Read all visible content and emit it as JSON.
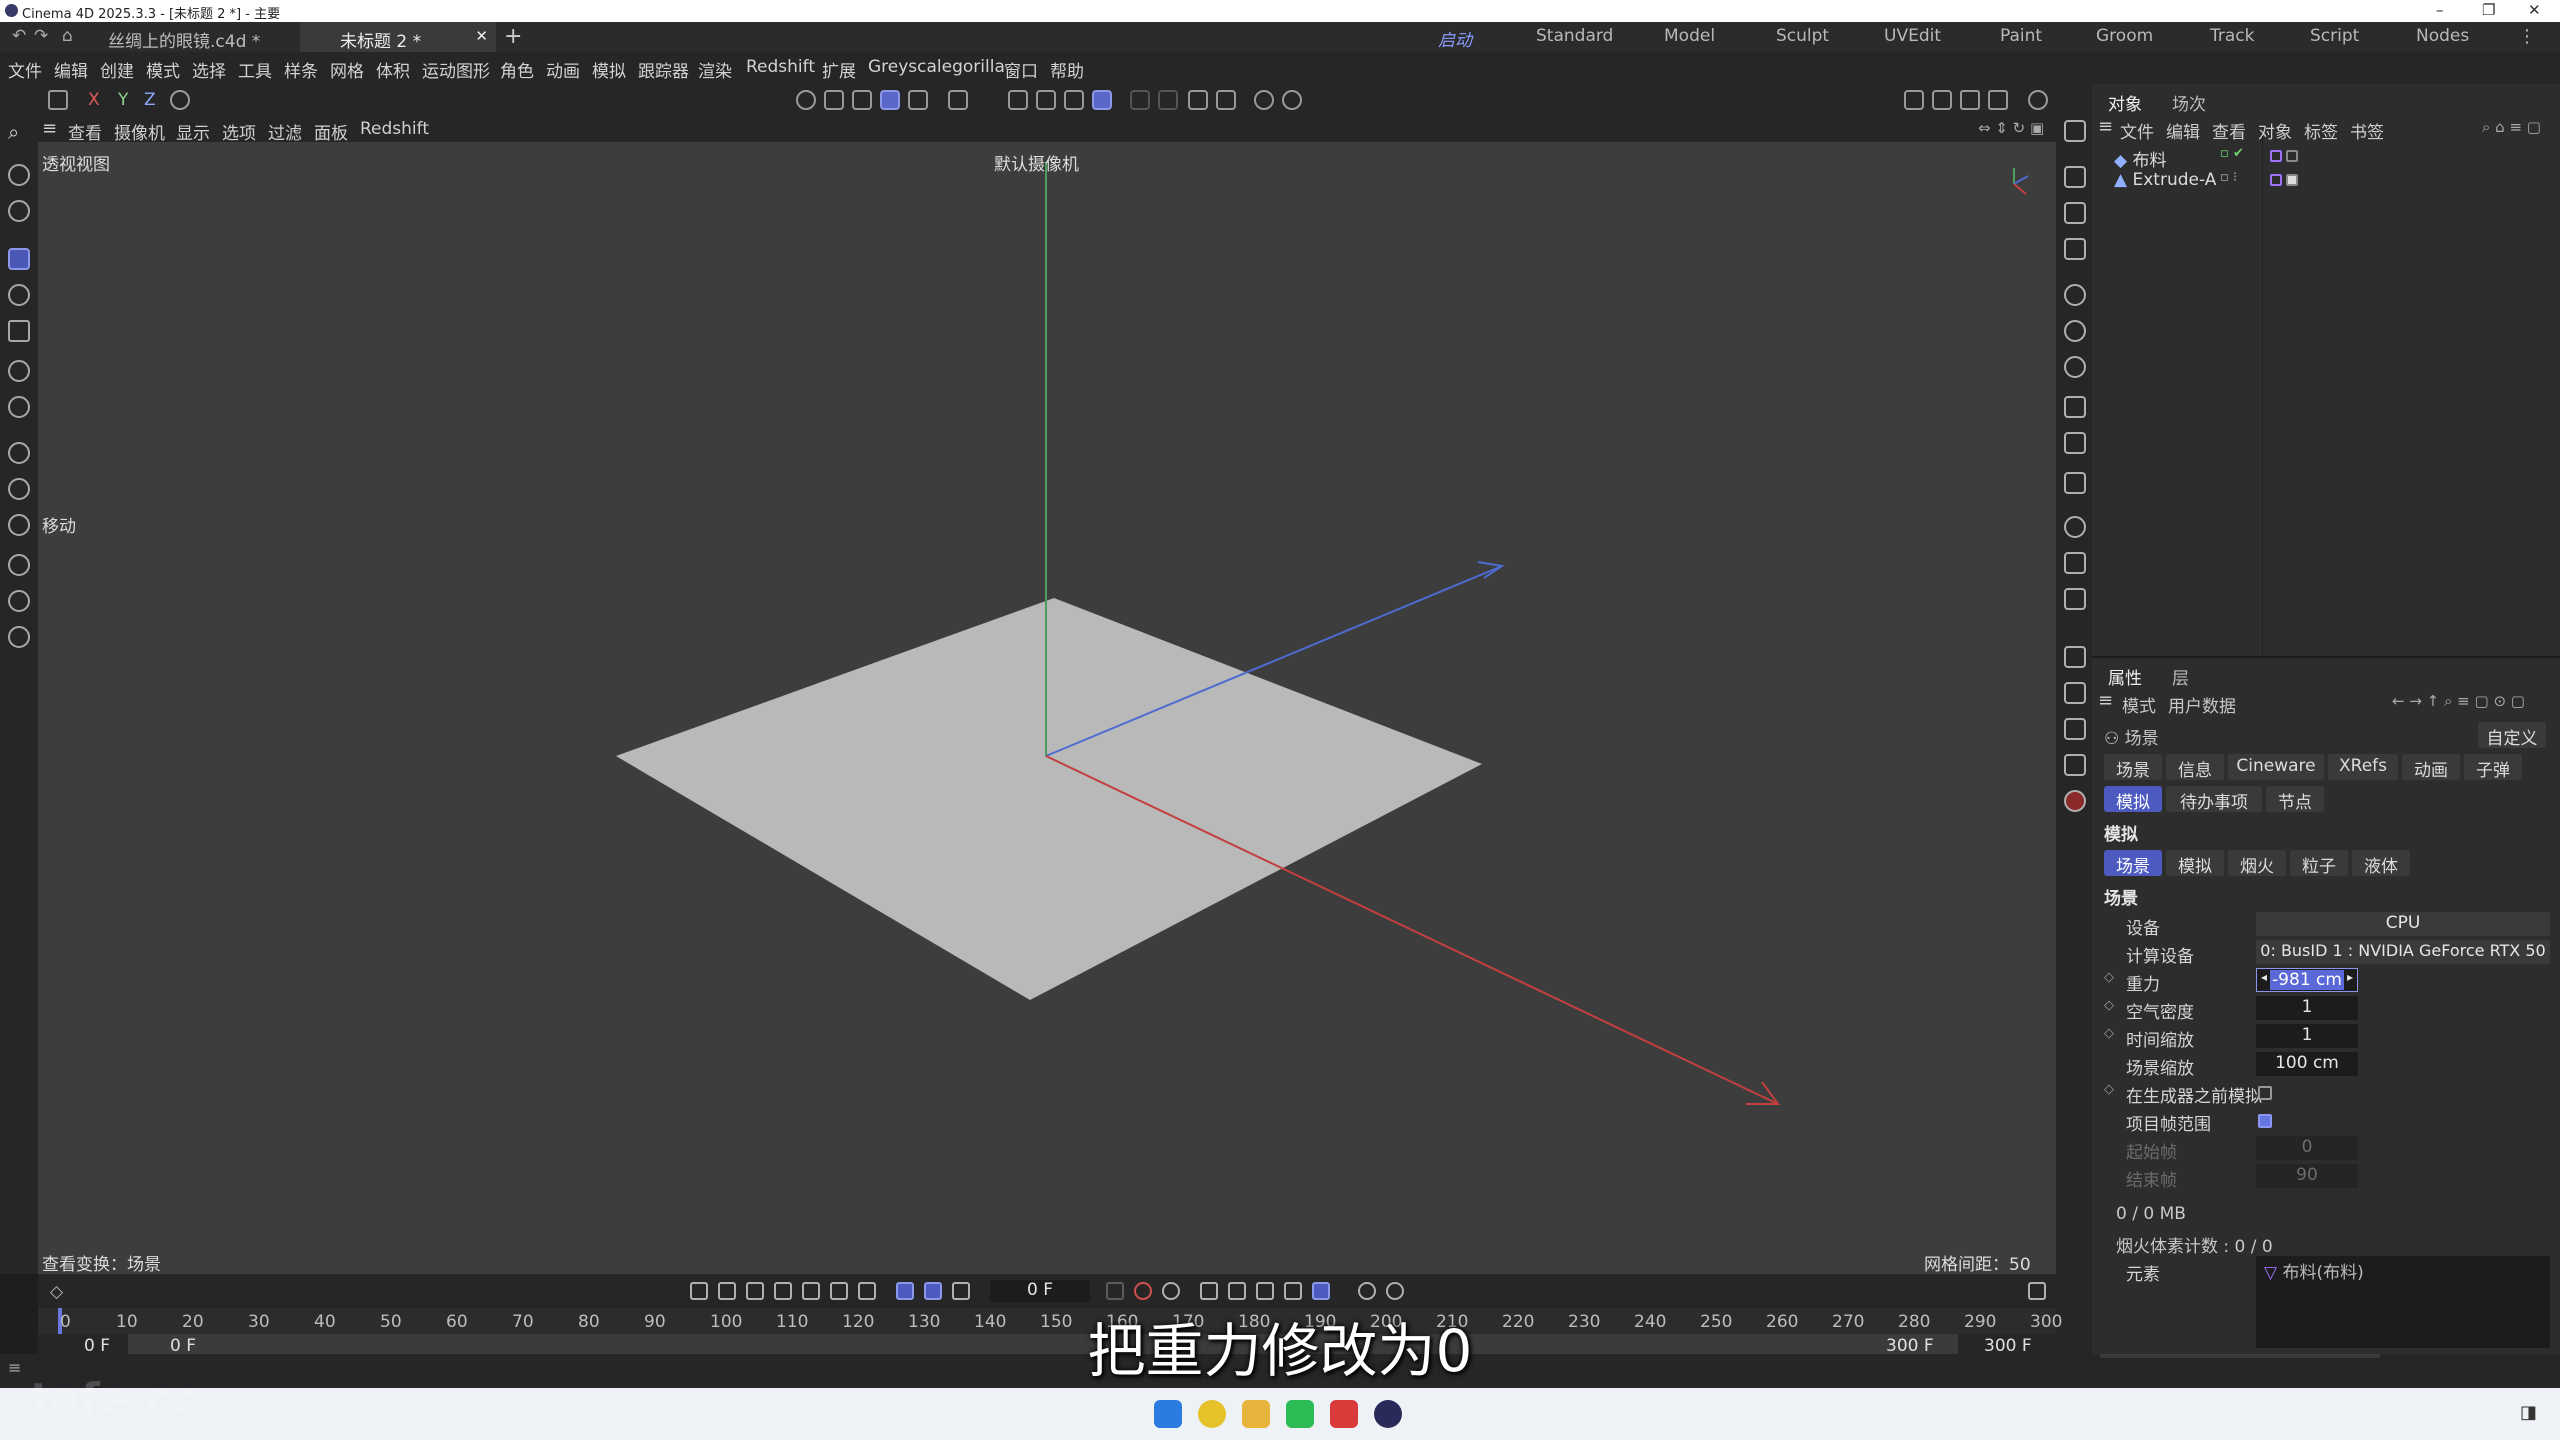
{
  "window": {
    "title": "Cinema 4D 2025.3.3 - [未标题 2 *] - 主要"
  },
  "doc_tabs": [
    {
      "label": "丝绸上的眼镜.c4d *"
    },
    {
      "label": "未标题 2 *"
    }
  ],
  "layouts": [
    "启动",
    "Standard",
    "Model",
    "Sculpt",
    "UVEdit",
    "Paint",
    "Groom",
    "Track",
    "Script",
    "Nodes"
  ],
  "menu": [
    "文件",
    "编辑",
    "创建",
    "模式",
    "选择",
    "工具",
    "样条",
    "网格",
    "体积",
    "运动图形",
    "角色",
    "动画",
    "模拟",
    "跟踪器",
    "渲染",
    "Redshift",
    "扩展",
    "Greyscalegorilla",
    "窗口",
    "帮助"
  ],
  "toolbar": {
    "axes": [
      "X",
      "Y",
      "Z"
    ]
  },
  "viewport": {
    "menu": [
      "查看",
      "摄像机",
      "显示",
      "选项",
      "过滤",
      "面板",
      "Redshift"
    ],
    "name": "透视视图",
    "camera": "默认摄像机",
    "tool_hint": "移动",
    "status_left": "查看变换：场景",
    "grid_spacing": "网格间距：50 cm",
    "colors": {
      "x_axis": "#c2413f",
      "y_axis": "#4aa05a",
      "z_axis": "#4d6bd0",
      "plane": "#b9b9b9",
      "bg": "#3d3d3d"
    }
  },
  "objects_panel": {
    "tabs": [
      "对象",
      "场次"
    ],
    "menu": [
      "文件",
      "编辑",
      "查看",
      "对象",
      "标签",
      "书签"
    ],
    "items": [
      {
        "name": "布料"
      },
      {
        "name": "Extrude-A"
      }
    ]
  },
  "attributes": {
    "tabs": [
      "属性",
      "层"
    ],
    "menu": [
      "模式",
      "用户数据"
    ],
    "context": "场景",
    "preset": "自定义",
    "row1": [
      "场景",
      "信息",
      "Cineware",
      "XRefs",
      "动画",
      "子弹"
    ],
    "row2": [
      "模拟",
      "待办事项",
      "节点"
    ],
    "section": "模拟",
    "subtabs": [
      "场景",
      "模拟",
      "烟火",
      "粒子",
      "液体"
    ],
    "subsection": "场景",
    "props": {
      "device_label": "设备",
      "device_value": "CPU",
      "compute_label": "计算设备",
      "compute_value": "0: BusID 1 : NVIDIA GeForce RTX 50",
      "gravity_label": "重力",
      "gravity_value": "-981 cm",
      "air_label": "空气密度",
      "air_value": "1",
      "time_label": "时间缩放",
      "time_value": "1",
      "scale_label": "场景缩放",
      "scale_value": "100 cm",
      "pre_label": "在生成器之前模拟",
      "range_label": "项目帧范围",
      "start_label": "起始帧",
      "start_value": "0",
      "end_label": "结束帧",
      "end_value": "90"
    },
    "memory": "0 / 0 MB",
    "voxels": "烟火体素计数 : 0 / 0",
    "elements_label": "元素",
    "elements_value": "布料(布料)"
  },
  "timeline": {
    "current_frame": "0 F",
    "ticks": [
      "0",
      "10",
      "20",
      "30",
      "40",
      "50",
      "60",
      "70",
      "80",
      "90",
      "100",
      "110",
      "120",
      "130",
      "140",
      "150",
      "160",
      "170",
      "180",
      "190",
      "200",
      "210",
      "220",
      "230",
      "240",
      "250",
      "260",
      "270",
      "280",
      "290",
      "300"
    ],
    "start_a": "0 F",
    "start_b": "0 F",
    "end_a": "300 F",
    "end_b": "300 F"
  },
  "subtitle": "把重力修改为0",
  "watermark": "tafe.cc"
}
